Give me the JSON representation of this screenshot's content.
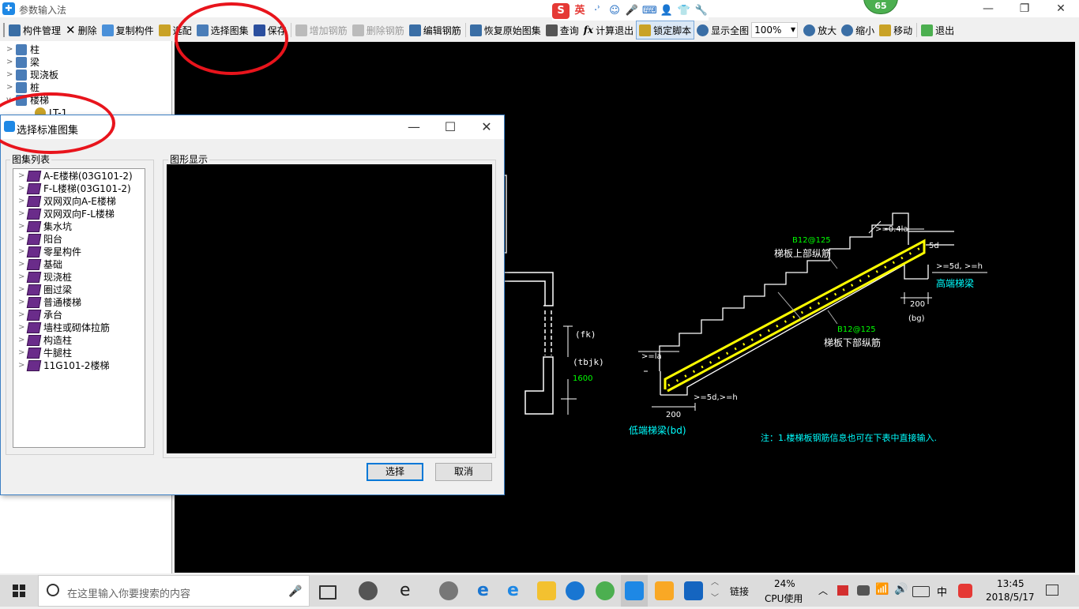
{
  "window": {
    "title": "参数输入法",
    "min": "—",
    "restore": "❐",
    "close": "✕"
  },
  "ime": {
    "logo": "S",
    "lang": "英",
    "items": [
      "·ʾ",
      "☺",
      "🎤",
      "⌨",
      "👤",
      "👕",
      "🔧"
    ]
  },
  "badge": "65",
  "toolbar": {
    "items": [
      {
        "label": "构件管理",
        "icon": "component-manage-icon",
        "color": "#3a6ea5",
        "disabled": false
      },
      {
        "label": "删除",
        "icon": "delete-x-icon",
        "color": "#333333",
        "disabled": false
      },
      {
        "label": "复制构件",
        "icon": "copy-icon",
        "color": "#4a90d9",
        "disabled": false
      },
      {
        "label": "选配",
        "icon": "select-config-icon",
        "color": "#c9a227",
        "disabled": false
      },
      {
        "label": "选择图集",
        "icon": "atlas-icon",
        "color": "#4a7db8",
        "disabled": false
      },
      {
        "label": "保存",
        "icon": "save-icon",
        "color": "#2b4f9e",
        "disabled": false
      },
      {
        "label": "增加钢筋",
        "icon": "add-rebar-icon",
        "color": "#999999",
        "disabled": true
      },
      {
        "label": "删除钢筋",
        "icon": "remove-rebar-icon",
        "color": "#999999",
        "disabled": true
      },
      {
        "label": "编辑钢筋",
        "icon": "edit-rebar-icon",
        "color": "#3a6ea5",
        "disabled": false
      },
      {
        "label": "恢复原始图集",
        "icon": "restore-atlas-icon",
        "color": "#3a6ea5",
        "disabled": false
      },
      {
        "label": "查询",
        "icon": "binoculars-icon",
        "color": "#555555",
        "disabled": false
      },
      {
        "label": "计算退出",
        "icon": "fx-icon",
        "color": "#333333",
        "disabled": false
      },
      {
        "label": "锁定脚本",
        "icon": "lock-icon",
        "color": "#c9a227",
        "disabled": false,
        "pressed": true
      },
      {
        "label": "显示全图",
        "icon": "zoom-fit-icon",
        "color": "#3a6ea5",
        "disabled": false
      }
    ],
    "zoom_value": "100%",
    "items2": [
      {
        "label": "放大",
        "icon": "zoom-in-icon",
        "color": "#3a6ea5"
      },
      {
        "label": "缩小",
        "icon": "zoom-out-icon",
        "color": "#3a6ea5"
      },
      {
        "label": "移动",
        "icon": "move-hand-icon",
        "color": "#c9a227"
      },
      {
        "label": "退出",
        "icon": "exit-icon",
        "color": "#4caf50"
      }
    ]
  },
  "tree": {
    "items": [
      {
        "label": "柱",
        "expanded": false
      },
      {
        "label": "梁",
        "expanded": false
      },
      {
        "label": "现浇板",
        "expanded": false
      },
      {
        "label": "桩",
        "expanded": false
      },
      {
        "label": "楼梯",
        "expanded": true
      },
      {
        "label": "LT-1",
        "expanded": false,
        "child": true
      }
    ]
  },
  "drawing": {
    "top_rebar_spec": "B12@125",
    "top_rebar_label": "梯板上部纵筋",
    "bottom_rebar_spec": "B12@125",
    "bottom_rebar_label": "梯板下部纵筋",
    "high_beam": "高端梯梁",
    "low_beam": "低端梯梁(bd)",
    "note": "注：1.楼梯板钢筋信息也可在下表中直接输入.",
    "dim_04la": ">=0.4la",
    "dim_5d_top": "5d",
    "dim_5d_h_top": ">=5d, >=h",
    "dim_200_top": "200",
    "dim_bg": "(bg)",
    "dim_la": ">=la",
    "dim_5d_h_bottom": ">=5d,>=h",
    "dim_200_bottom": "200",
    "fk": "(fk)",
    "tbjk": "(tbjk)",
    "dim_1600": "1600"
  },
  "dialog": {
    "title": "选择标准图集",
    "list_label": "图集列表",
    "preview_label": "图形显示",
    "items": [
      "A-E楼梯(03G101-2)",
      "F-L楼梯(03G101-2)",
      "双网双向A-E楼梯",
      "双网双向F-L楼梯",
      "集水坑",
      "阳台",
      "零星构件",
      "基础",
      "现浇桩",
      "圈过梁",
      "普通楼梯",
      "承台",
      "墙柱或砌体拉筋",
      "构造柱",
      "牛腿柱",
      "11G101-2楼梯"
    ],
    "select_button": "选择",
    "cancel_button": "取消"
  },
  "taskbar": {
    "search_placeholder": "在这里输入你要搜索的内容",
    "link_label": "链接",
    "cpu_percent": "24%",
    "cpu_label": "CPU使用",
    "lang": "中",
    "time": "13:45",
    "date": "2018/5/17"
  },
  "colors": {
    "annotation_red": "#e8141c",
    "rebar_yellow": "#ffff00",
    "label_green": "#00ff00",
    "label_cyan": "#00ffff"
  }
}
